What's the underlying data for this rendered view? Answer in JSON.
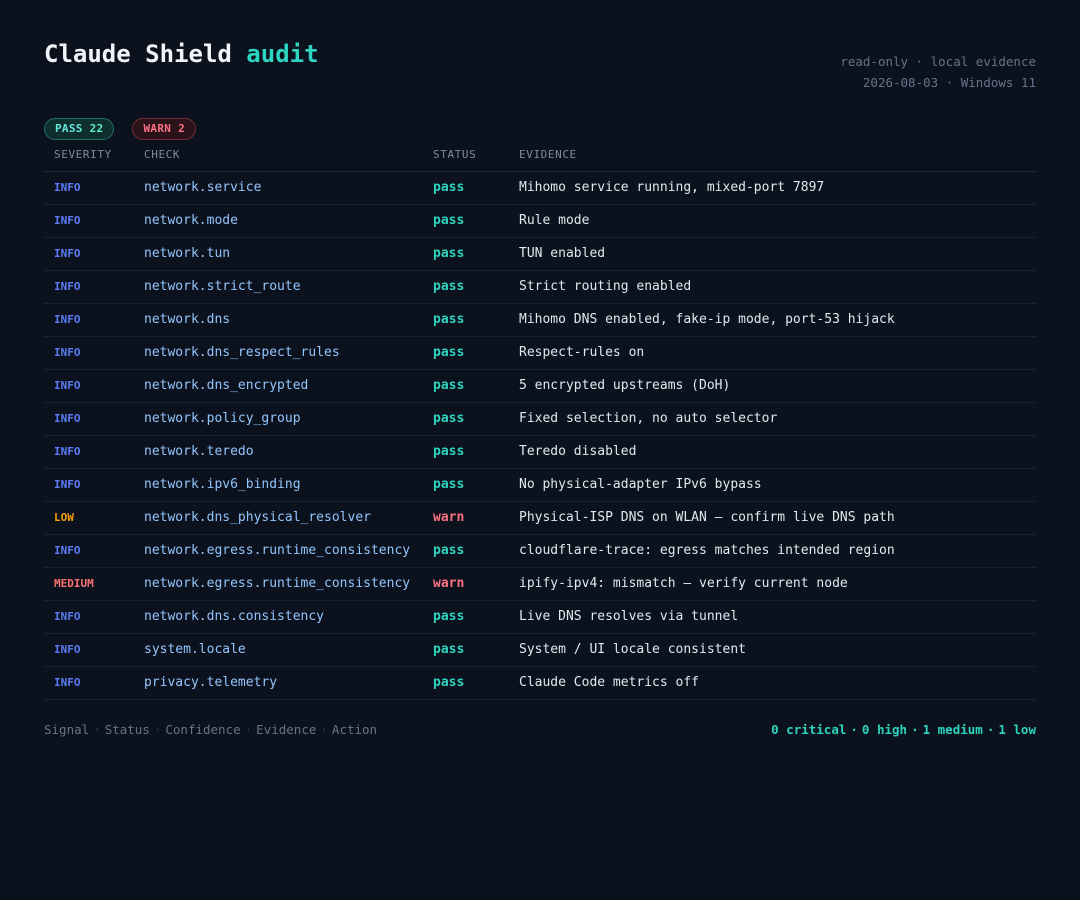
{
  "header": {
    "title": "Claude Shield",
    "title_accent": "audit",
    "meta_line1": "read-only · local evidence",
    "meta_line2": "2026-08-03 · Windows 11"
  },
  "badges": {
    "pass": "PASS 22",
    "warn": "WARN 2"
  },
  "table": {
    "columns": [
      "SEVERITY",
      "CHECK",
      "STATUS",
      "EVIDENCE"
    ],
    "rows": [
      {
        "severity": "INFO",
        "check": "network.service",
        "status": "pass",
        "evidence": "Mihomo service running, mixed-port 7897"
      },
      {
        "severity": "INFO",
        "check": "network.mode",
        "status": "pass",
        "evidence": "Rule mode"
      },
      {
        "severity": "INFO",
        "check": "network.tun",
        "status": "pass",
        "evidence": "TUN enabled"
      },
      {
        "severity": "INFO",
        "check": "network.strict_route",
        "status": "pass",
        "evidence": "Strict routing enabled"
      },
      {
        "severity": "INFO",
        "check": "network.dns",
        "status": "pass",
        "evidence": "Mihomo DNS enabled, fake-ip mode, port-53 hijack"
      },
      {
        "severity": "INFO",
        "check": "network.dns_respect_rules",
        "status": "pass",
        "evidence": "Respect-rules on"
      },
      {
        "severity": "INFO",
        "check": "network.dns_encrypted",
        "status": "pass",
        "evidence": "5 encrypted upstreams (DoH)"
      },
      {
        "severity": "INFO",
        "check": "network.policy_group",
        "status": "pass",
        "evidence": "Fixed selection, no auto selector"
      },
      {
        "severity": "INFO",
        "check": "network.teredo",
        "status": "pass",
        "evidence": "Teredo disabled"
      },
      {
        "severity": "INFO",
        "check": "network.ipv6_binding",
        "status": "pass",
        "evidence": "No physical-adapter IPv6 bypass"
      },
      {
        "severity": "LOW",
        "check": "network.dns_physical_resolver",
        "status": "warn",
        "evidence": "Physical-ISP DNS on WLAN — confirm live DNS path"
      },
      {
        "severity": "INFO",
        "check": "network.egress.runtime_consistency",
        "status": "pass",
        "evidence": "cloudflare-trace: egress matches intended region"
      },
      {
        "severity": "MEDIUM",
        "check": "network.egress.runtime_consistency",
        "status": "warn",
        "evidence": "ipify-ipv4: mismatch — verify current node"
      },
      {
        "severity": "INFO",
        "check": "network.dns.consistency",
        "status": "pass",
        "evidence": "Live DNS resolves via tunnel"
      },
      {
        "severity": "INFO",
        "check": "system.locale",
        "status": "pass",
        "evidence": "System / UI locale consistent"
      },
      {
        "severity": "INFO",
        "check": "privacy.telemetry",
        "status": "pass",
        "evidence": "Claude Code metrics off"
      }
    ]
  },
  "footer": {
    "legend": [
      "Signal",
      "Status",
      "Confidence",
      "Evidence",
      "Action"
    ],
    "summary": [
      "0 critical",
      "0 high",
      "1 medium",
      "1 low"
    ]
  },
  "colors": {
    "background": "#0b121d",
    "accent": "#2dd4bf",
    "info": "#5b7cf6",
    "low": "#f59e0b",
    "medium": "#f87171",
    "warn": "#fb7185"
  }
}
